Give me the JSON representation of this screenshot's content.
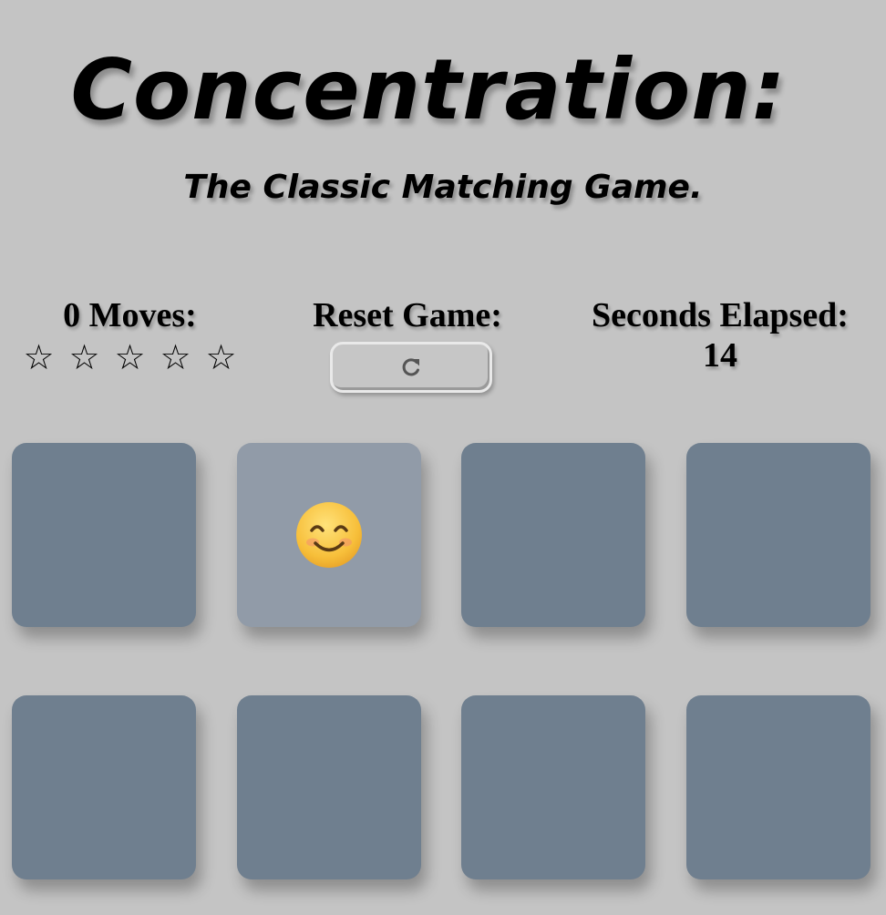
{
  "header": {
    "title": "Concentration:",
    "subtitle": "The Classic Matching Game."
  },
  "score_panel": {
    "moves_label": "0 Moves:",
    "moves": 0,
    "stars_total": 5,
    "stars_filled": 0,
    "star_glyph": "☆",
    "reset_label": "Reset Game:",
    "reset_icon": "refresh-icon",
    "timer_label": "Seconds Elapsed:",
    "seconds": "14"
  },
  "deck": {
    "columns": 4,
    "rows": 2,
    "card_back_color": "#6f7f8f",
    "card_open_color": "#919ba8",
    "cards": [
      {
        "state": "closed",
        "face": ""
      },
      {
        "state": "open",
        "face": "smiling-face-icon"
      },
      {
        "state": "closed",
        "face": ""
      },
      {
        "state": "closed",
        "face": ""
      },
      {
        "state": "closed",
        "face": ""
      },
      {
        "state": "closed",
        "face": ""
      },
      {
        "state": "closed",
        "face": ""
      },
      {
        "state": "closed",
        "face": ""
      }
    ]
  }
}
